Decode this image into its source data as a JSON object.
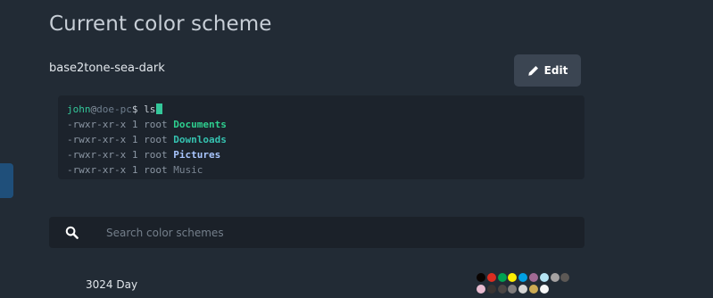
{
  "header": {
    "title": "Current color scheme"
  },
  "current_scheme": {
    "name": "base2tone-sea-dark",
    "edit_label": "Edit"
  },
  "terminal": {
    "prompt": {
      "user": "john",
      "at": "@",
      "host": "doe-pc",
      "symbol": "$",
      "command": " ls"
    },
    "lines": [
      {
        "perms": "-rwxr-xr-x 1 root ",
        "name": "Documents"
      },
      {
        "perms": "-rwxr-xr-x 1 root ",
        "name": "Downloads"
      },
      {
        "perms": "-rwxr-xr-x 1 root ",
        "name": "Pictures"
      },
      {
        "perms": "-rwxr-xr-x 1 root ",
        "name": "Music"
      }
    ]
  },
  "search": {
    "placeholder": "Search color schemes",
    "value": ""
  },
  "schemes": [
    {
      "name": "3024 Day",
      "palette": [
        "#090300",
        "#db2d20",
        "#01a252",
        "#fded02",
        "#01a0e4",
        "#a16a94",
        "#b5e4f4",
        "#a5a2a2",
        "#5c5855",
        "#e8bbd0",
        "#3a3432",
        "#4a4543",
        "#807d7c",
        "#d6d5d4",
        "#cdab53",
        "#f7f7f7"
      ]
    }
  ],
  "colors": {
    "background": "#222b35",
    "accent": "#34c79a",
    "button": "#3b4552"
  }
}
